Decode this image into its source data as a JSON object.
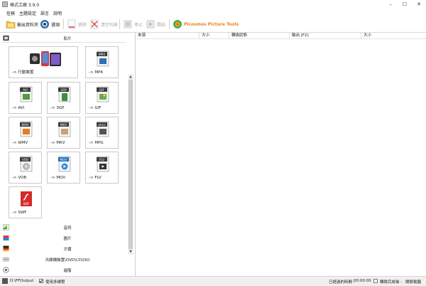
{
  "window": {
    "title": "格式工廠 3.9.0",
    "minimize": "–",
    "maximize": "☐",
    "close": "✕"
  },
  "menu": [
    "任務",
    "主題設定",
    "語言",
    "說明"
  ],
  "toolbar": {
    "output_folder": "輸出資料夾",
    "options": "選項",
    "remove": "移除",
    "clear_list": "清空列表",
    "stop": "停止",
    "start": "開始",
    "brand": "Picosmos Picture Tools"
  },
  "left_panel": {
    "video_header": "影片",
    "tiles": [
      {
        "label": "-> 行動裝置",
        "icon": "mobile-device-icon"
      },
      {
        "label": "-> MP4",
        "icon": "mp4-file-icon",
        "badge": "MP4"
      },
      {
        "label": "-> AVI",
        "icon": "avi-file-icon",
        "badge": "AVI"
      },
      {
        "label": "-> 3GP",
        "icon": "3gp-file-icon",
        "badge": "3GP"
      },
      {
        "label": "-> GIF",
        "icon": "gif-file-icon",
        "badge": "GIF"
      },
      {
        "label": "-> WMV",
        "icon": "wmv-file-icon",
        "badge": "WMV"
      },
      {
        "label": "-> MKV",
        "icon": "mkv-file-icon",
        "badge": "MKV"
      },
      {
        "label": "-> MPG",
        "icon": "mpg-file-icon",
        "badge": "MPEG"
      },
      {
        "label": "-> VOB",
        "icon": "vob-file-icon",
        "badge": "VOB"
      },
      {
        "label": "-> MOV",
        "icon": "mov-file-icon",
        "badge": "MOV"
      },
      {
        "label": "-> FLV",
        "icon": "flv-file-icon",
        "badge": "FLV"
      },
      {
        "label": "-> SWF",
        "icon": "swf-file-icon",
        "badge": "SWF"
      }
    ],
    "categories": [
      "音訊",
      "圖片",
      "文檔",
      "光碟機裝置\\DVD\\CD\\ISO",
      "進階"
    ]
  },
  "table": {
    "columns": [
      "來源",
      "大小",
      "轉換狀態",
      "輸出 [F2]",
      "大小"
    ]
  },
  "status": {
    "output_path": "D:\\FFOutput",
    "multithread_label": "使用多線程",
    "multithread_checked": true,
    "elapsed_label": "已經過的時間 :",
    "elapsed_value": "00:00:00",
    "after_convert_label": "轉換完成後 :",
    "after_convert_value": "關閉電腦"
  },
  "colors": {
    "accent_orange": "#e8841a",
    "selection_blue": "#1e6fc6"
  }
}
